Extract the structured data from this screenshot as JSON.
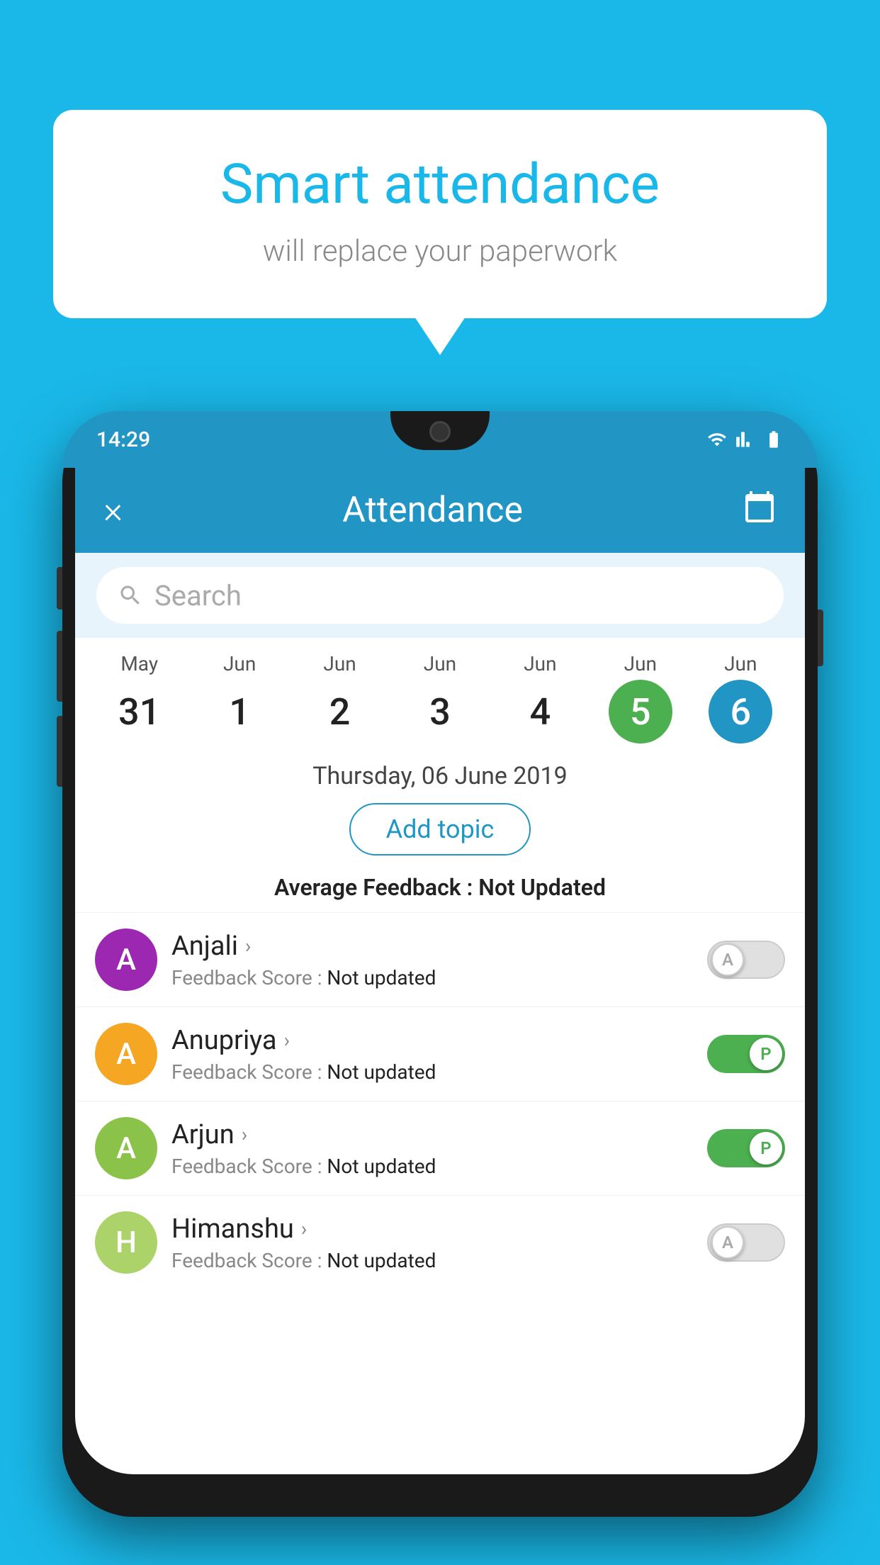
{
  "background": {
    "color": "#1ab8e8"
  },
  "speech_bubble": {
    "title": "Smart attendance",
    "subtitle": "will replace your paperwork"
  },
  "phone": {
    "status_bar": {
      "time": "14:29"
    },
    "header": {
      "title": "Attendance",
      "close_label": "×"
    },
    "search": {
      "placeholder": "Search"
    },
    "dates": [
      {
        "month": "May",
        "day": "31",
        "variant": "normal"
      },
      {
        "month": "Jun",
        "day": "1",
        "variant": "normal"
      },
      {
        "month": "Jun",
        "day": "2",
        "variant": "normal"
      },
      {
        "month": "Jun",
        "day": "3",
        "variant": "normal"
      },
      {
        "month": "Jun",
        "day": "4",
        "variant": "normal"
      },
      {
        "month": "Jun",
        "day": "5",
        "variant": "today"
      },
      {
        "month": "Jun",
        "day": "6",
        "variant": "selected"
      }
    ],
    "selected_date": {
      "text": "Thursday, 06 June 2019",
      "add_topic_label": "Add topic",
      "avg_feedback_label": "Average Feedback :",
      "avg_feedback_value": "Not Updated"
    },
    "students": [
      {
        "name": "Anjali",
        "avatar_letter": "A",
        "avatar_color": "purple",
        "feedback": "Not updated",
        "toggle_state": "off",
        "toggle_label": "A"
      },
      {
        "name": "Anupriya",
        "avatar_letter": "A",
        "avatar_color": "yellow",
        "feedback": "Not updated",
        "toggle_state": "on",
        "toggle_label": "P"
      },
      {
        "name": "Arjun",
        "avatar_letter": "A",
        "avatar_color": "green",
        "feedback": "Not updated",
        "toggle_state": "on",
        "toggle_label": "P"
      },
      {
        "name": "Himanshu",
        "avatar_letter": "H",
        "avatar_color": "lightgreen",
        "feedback": "Not updated",
        "toggle_state": "off",
        "toggle_label": "A"
      }
    ]
  }
}
